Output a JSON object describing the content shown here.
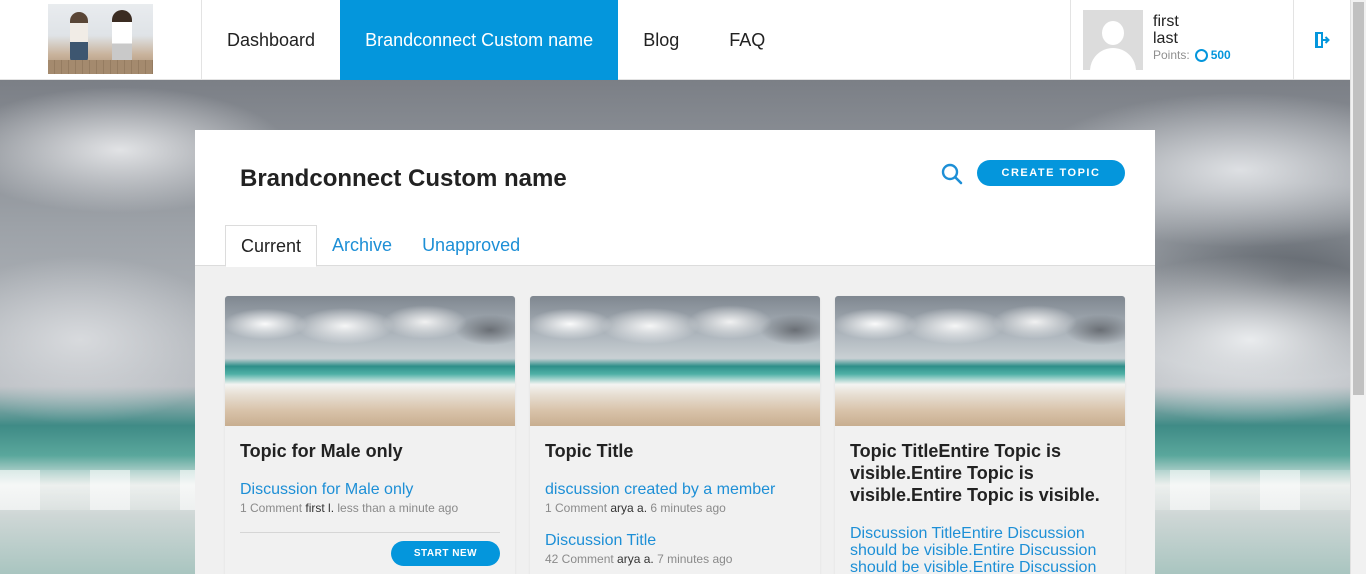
{
  "header": {
    "logo_alt": "brand logo",
    "nav": [
      {
        "label": "Dashboard",
        "active": false
      },
      {
        "label": "Brandconnect Custom name",
        "active": true
      },
      {
        "label": "Blog",
        "active": false
      },
      {
        "label": "FAQ",
        "active": false
      }
    ],
    "user": {
      "first_name": "first",
      "last_name": "last",
      "points_label": "Points:",
      "points_value": "500"
    },
    "logout_icon": "logout-icon"
  },
  "main": {
    "title": "Brandconnect Custom name",
    "search_icon": "search-icon",
    "create_label": "CREATE TOPIC",
    "tabs": [
      {
        "label": "Current",
        "active": true
      },
      {
        "label": "Archive",
        "active": false
      },
      {
        "label": "Unapproved",
        "active": false
      }
    ]
  },
  "cards": [
    {
      "title": "Topic for Male only",
      "discussions": [
        {
          "title": "Discussion for Male only",
          "comments": "1 Comment",
          "author": "first l.",
          "time": "less than a minute ago"
        }
      ],
      "button_label": "START NEW"
    },
    {
      "title": "Topic Title",
      "discussions": [
        {
          "title": "discussion created by a member",
          "comments": "1 Comment",
          "author": "arya a.",
          "time": "6 minutes ago"
        },
        {
          "title": "Discussion Title",
          "comments": "42 Comment",
          "author": "arya a.",
          "time": "7 minutes ago"
        }
      ]
    },
    {
      "title": "Topic TitleEntire Topic is visible.Entire Topic is visible.Entire Topic is visible.",
      "discussions": [
        {
          "title": "Discussion TitleEntire Discussion should be visible.Entire Discussion should be visible.Entire Discussion"
        }
      ]
    }
  ],
  "colors": {
    "accent": "#0496dc",
    "link": "#1d8fd6"
  }
}
